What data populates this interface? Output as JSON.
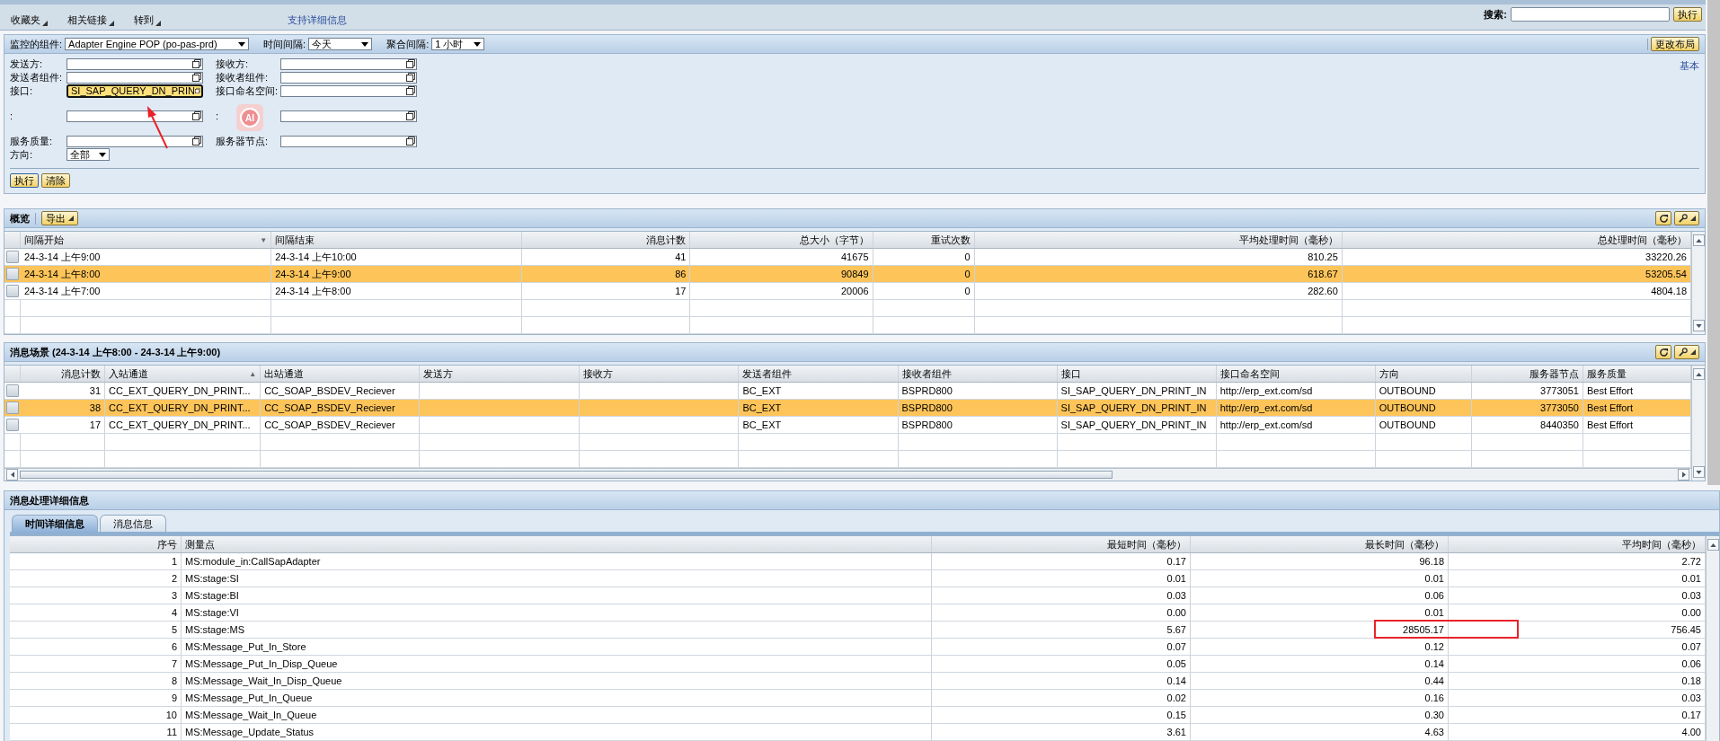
{
  "toolbar": {
    "menus": [
      {
        "label": "收藏夹"
      },
      {
        "label": "相关链接"
      },
      {
        "label": "转到"
      }
    ],
    "link": "支持详细信息",
    "search_label": "搜索:",
    "search_button": "执行"
  },
  "filter": {
    "selectors": [
      {
        "label": "监控的组件:",
        "value": "Adapter Engine POP (po-pas-prd)"
      },
      {
        "label": "时间间隔:",
        "value": "今天"
      },
      {
        "label": "聚合间隔:",
        "value": "1 小时"
      }
    ],
    "layout_button": "更改布局",
    "mode_link": "基本",
    "field_groups": [
      [
        {
          "left": {
            "label": "发送方:",
            "focused": false
          },
          "right": {
            "label": "接收方:",
            "focused": false
          }
        },
        {
          "left": {
            "label": "发送者组件:",
            "focused": false
          },
          "right": {
            "label": "接收者组件:",
            "focused": false
          }
        },
        {
          "left": {
            "label": "接口:",
            "value": "SI_SAP_QUERY_DN_PRIN",
            "focused": true
          },
          "right": {
            "label": "接口命名空间:",
            "focused": false
          }
        }
      ],
      [
        {
          "left": {
            "label": ":",
            "focused": false
          },
          "right": {
            "label": ":",
            "focused": false
          }
        }
      ],
      [
        {
          "left": {
            "label": "服务质量:",
            "focused": false
          },
          "right": {
            "label": "服务器节点:",
            "focused": false
          }
        }
      ]
    ],
    "direction": {
      "label": "方向:",
      "value": "全部"
    },
    "buttons": [
      "执行",
      "清除"
    ],
    "ai_badge": "AI"
  },
  "overview": {
    "title": "概览",
    "export_button": "导出",
    "columns": [
      {
        "label": "间隔开始",
        "sort_mark": "▼"
      },
      {
        "label": "间隔结束"
      },
      {
        "label": "消息计数"
      },
      {
        "label": "总大小（字节）"
      },
      {
        "label": "重试次数"
      },
      {
        "label": "平均处理时间（毫秒）"
      },
      {
        "label": "总处理时间（毫秒）"
      }
    ],
    "rows": [
      {
        "cells": [
          "24-3-14 上午9:00",
          "24-3-14 上午10:00",
          "41",
          "41675",
          "0",
          "810.25",
          "33220.26"
        ],
        "selected": false
      },
      {
        "cells": [
          "24-3-14 上午8:00",
          "24-3-14 上午9:00",
          "86",
          "90849",
          "0",
          "618.67",
          "53205.54"
        ],
        "selected": true
      },
      {
        "cells": [
          "24-3-14 上午7:00",
          "24-3-14 上午8:00",
          "17",
          "20006",
          "0",
          "282.60",
          "4804.18"
        ],
        "selected": false
      }
    ]
  },
  "scenario": {
    "title": "消息场景 (24-3-14 上午8:00 - 24-3-14 上午9:00)",
    "columns": [
      {
        "label": "消息计数"
      },
      {
        "label": "入站通道",
        "sort_mark": "▲"
      },
      {
        "label": "出站通道"
      },
      {
        "label": "发送方"
      },
      {
        "label": "接收方"
      },
      {
        "label": "发送者组件"
      },
      {
        "label": "接收者组件"
      },
      {
        "label": "接口"
      },
      {
        "label": "接口命名空间"
      },
      {
        "label": "方向"
      },
      {
        "label": "服务器节点"
      },
      {
        "label": "服务质量"
      }
    ],
    "rows": [
      {
        "cells": [
          "31",
          "CC_EXT_QUERY_DN_PRINT...",
          "CC_SOAP_BSDEV_Reciever",
          null,
          null,
          "BC_EXT",
          "BSPRD800",
          "SI_SAP_QUERY_DN_PRINT_IN",
          "http://erp_ext.com/sd",
          "OUTBOUND",
          "3773051",
          "Best Effort"
        ],
        "selected": false
      },
      {
        "cells": [
          "38",
          "CC_EXT_QUERY_DN_PRINT...",
          "CC_SOAP_BSDEV_Reciever",
          null,
          null,
          "BC_EXT",
          "BSPRD800",
          "SI_SAP_QUERY_DN_PRINT_IN",
          "http://erp_ext.com/sd",
          "OUTBOUND",
          "3773050",
          "Best Effort"
        ],
        "selected": true
      },
      {
        "cells": [
          "17",
          "CC_EXT_QUERY_DN_PRINT...",
          "CC_SOAP_BSDEV_Reciever",
          null,
          null,
          "BC_EXT",
          "BSPRD800",
          "SI_SAP_QUERY_DN_PRINT_IN",
          "http://erp_ext.com/sd",
          "OUTBOUND",
          "8440350",
          "Best Effort"
        ],
        "selected": false
      }
    ]
  },
  "details": {
    "title": "消息处理详细信息",
    "tabs": [
      {
        "label": "时间详细信息",
        "selected": true
      },
      {
        "label": "消息信息",
        "selected": false
      }
    ],
    "columns": [
      {
        "label": "序号"
      },
      {
        "label": "测量点"
      },
      {
        "label": "最短时间（毫秒）"
      },
      {
        "label": "最长时间（毫秒）"
      },
      {
        "label": "平均时间（毫秒）"
      }
    ],
    "rows": [
      {
        "cells": [
          "1",
          "MS:module_in:CallSapAdapter",
          "0.17",
          "96.18",
          "2.72"
        ]
      },
      {
        "cells": [
          "2",
          "MS:stage:SI",
          "0.01",
          "0.01",
          "0.01"
        ]
      },
      {
        "cells": [
          "3",
          "MS:stage:BI",
          "0.03",
          "0.06",
          "0.03"
        ]
      },
      {
        "cells": [
          "4",
          "MS:stage:VI",
          "0.00",
          "0.01",
          "0.00"
        ]
      },
      {
        "cells": [
          "5",
          "MS:stage:MS",
          "5.67",
          "28505.17",
          "756.45"
        ]
      },
      {
        "cells": [
          "6",
          "MS:Message_Put_In_Store",
          "0.07",
          "0.12",
          "0.07"
        ]
      },
      {
        "cells": [
          "7",
          "MS:Message_Put_In_Disp_Queue",
          "0.05",
          "0.14",
          "0.06"
        ]
      },
      {
        "cells": [
          "8",
          "MS:Message_Wait_In_Disp_Queue",
          "0.14",
          "0.44",
          "0.18"
        ]
      },
      {
        "cells": [
          "9",
          "MS:Message_Put_In_Queue",
          "0.02",
          "0.16",
          "0.03"
        ]
      },
      {
        "cells": [
          "10",
          "MS:Message_Wait_In_Queue",
          "0.15",
          "0.30",
          "0.17"
        ]
      },
      {
        "cells": [
          "11",
          "MS:Message_Update_Status",
          "3.61",
          "4.63",
          "4.00"
        ]
      }
    ]
  }
}
